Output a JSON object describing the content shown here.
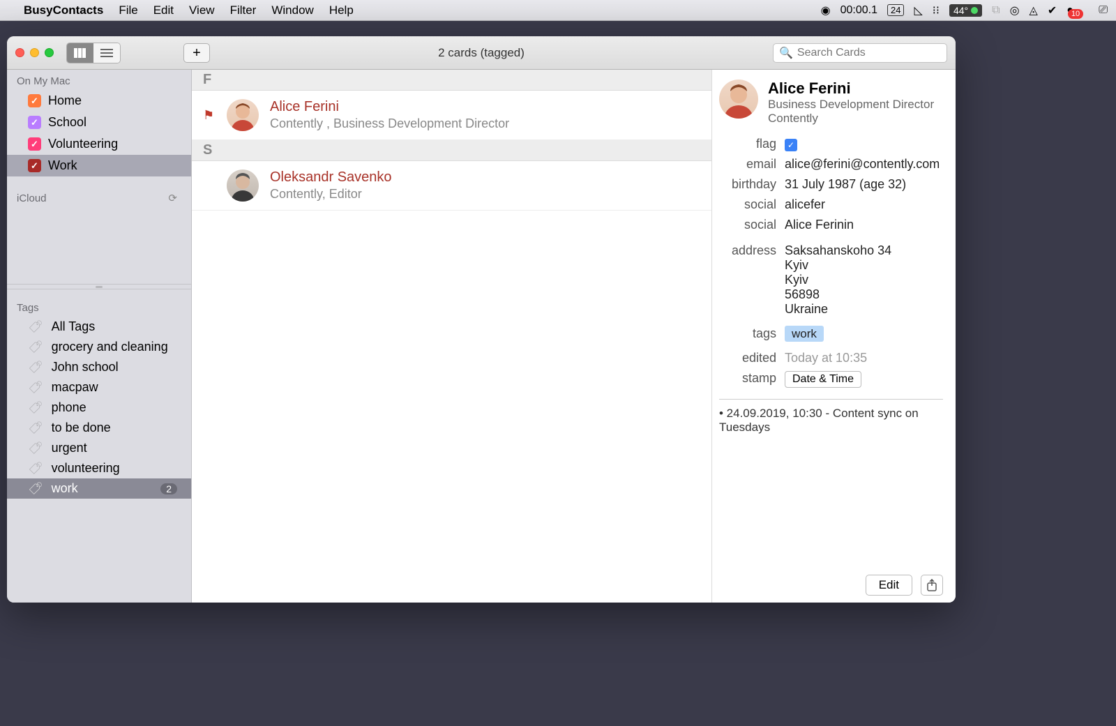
{
  "menubar": {
    "appname": "BusyContacts",
    "items": [
      "File",
      "Edit",
      "View",
      "Filter",
      "Window",
      "Help"
    ],
    "status": {
      "timer": "00:00.1",
      "date": "24",
      "temp": "44°",
      "notif": "10"
    }
  },
  "toolbar": {
    "title": "2 cards (tagged)",
    "search_placeholder": "Search Cards"
  },
  "sidebar": {
    "section1": "On My Mac",
    "lists": [
      {
        "label": "Home",
        "color": "#ff7a3d"
      },
      {
        "label": "School",
        "color": "#b97dff"
      },
      {
        "label": "Volunteering",
        "color": "#ff3d7a"
      },
      {
        "label": "Work",
        "color": "#a82a28",
        "selected": true
      }
    ],
    "section2": "iCloud",
    "section3": "Tags",
    "tags": [
      {
        "label": "All Tags"
      },
      {
        "label": "grocery and cleaning"
      },
      {
        "label": "John school"
      },
      {
        "label": "macpaw"
      },
      {
        "label": "phone"
      },
      {
        "label": "to be done"
      },
      {
        "label": "urgent"
      },
      {
        "label": "volunteering"
      },
      {
        "label": "work",
        "count": "2",
        "selected": true
      }
    ]
  },
  "list": {
    "sections": [
      {
        "letter": "F",
        "cards": [
          {
            "name": "Alice Ferini",
            "sub": "Contently , Business Development Director",
            "flagged": true
          }
        ]
      },
      {
        "letter": "S",
        "cards": [
          {
            "name": "Oleksandr Savenko",
            "sub": "Contently, Editor",
            "flagged": false
          }
        ]
      }
    ]
  },
  "detail": {
    "name": "Alice Ferini",
    "title": "Business Development Director",
    "company": "Contently",
    "rows": {
      "flag_label": "flag",
      "email_label": "email",
      "email": "alice@ferini@contently.com",
      "birthday_label": "birthday",
      "birthday": "31 July 1987 (age 32)",
      "social1_label": "social",
      "social1": "alicefer",
      "social2_label": "social",
      "social2": "Alice Ferinin",
      "address_label": "address",
      "address_lines": [
        "Saksahanskoho 34",
        "Kyiv",
        "Kyiv",
        "56898",
        "Ukraine"
      ],
      "tags_label": "tags",
      "tag": "work",
      "edited_label": "edited",
      "edited": "Today at 10:35",
      "stamp_label": "stamp",
      "stamp_btn": "Date & Time"
    },
    "note": "• 24.09.2019, 10:30 - Content sync on Tuesdays",
    "edit_btn": "Edit"
  }
}
